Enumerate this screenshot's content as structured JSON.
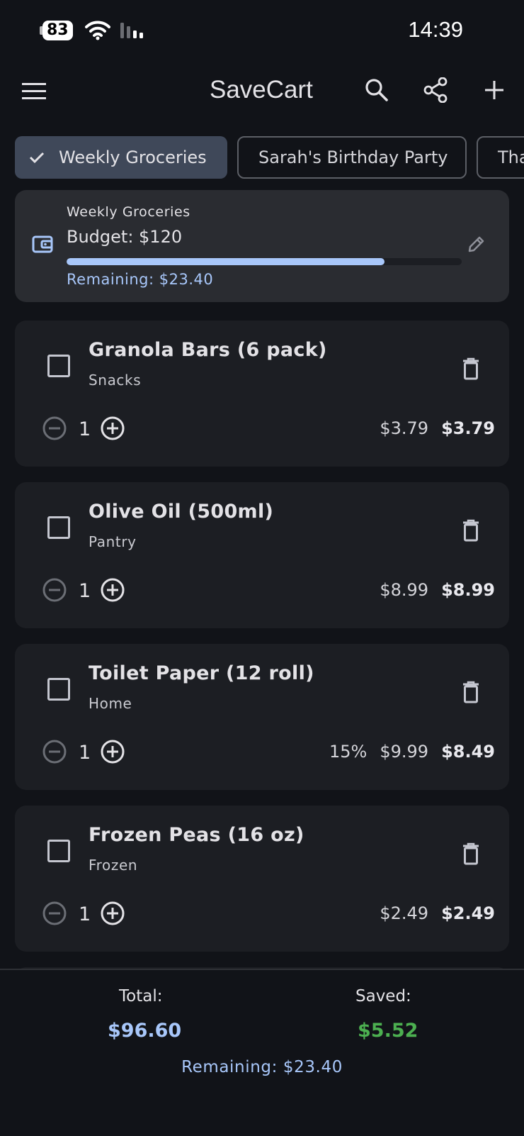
{
  "status_bar": {
    "battery": "83",
    "time": "14:39"
  },
  "app_bar": {
    "title": "SaveCart",
    "icons": [
      "menu-icon",
      "search-icon",
      "share-icon",
      "add-icon"
    ]
  },
  "lists": [
    {
      "label": "Weekly Groceries",
      "selected": true
    },
    {
      "label": "Sarah's Birthday Party",
      "selected": false
    },
    {
      "label": "Tha",
      "selected": false
    }
  ],
  "budget": {
    "list_name": "Weekly Groceries",
    "amount_label": "Budget: $120",
    "remaining_label": "Remaining: $23.40",
    "progress_fraction": 0.805
  },
  "items": [
    {
      "name": "Granola Bars (6 pack)",
      "category": "Snacks",
      "qty": "1",
      "discount": "",
      "price": "$3.79",
      "total": "$3.79"
    },
    {
      "name": "Olive Oil (500ml)",
      "category": "Pantry",
      "qty": "1",
      "discount": "",
      "price": "$8.99",
      "total": "$8.99"
    },
    {
      "name": "Toilet Paper (12 roll)",
      "category": "Home",
      "qty": "1",
      "discount": "15%",
      "price": "$9.99",
      "total": "$8.49"
    },
    {
      "name": "Frozen Peas (16 oz)",
      "category": "Frozen",
      "qty": "1",
      "discount": "",
      "price": "$2.49",
      "total": "$2.49"
    }
  ],
  "summary": {
    "total_label": "Total:",
    "total_value": "$96.60",
    "saved_label": "Saved:",
    "saved_value": "$5.52",
    "remaining_label": "Remaining: $23.40"
  },
  "colors": {
    "accent": "#a8c7fa",
    "saved": "#4caf50",
    "background": "#111318",
    "card": "#1c1e23"
  }
}
